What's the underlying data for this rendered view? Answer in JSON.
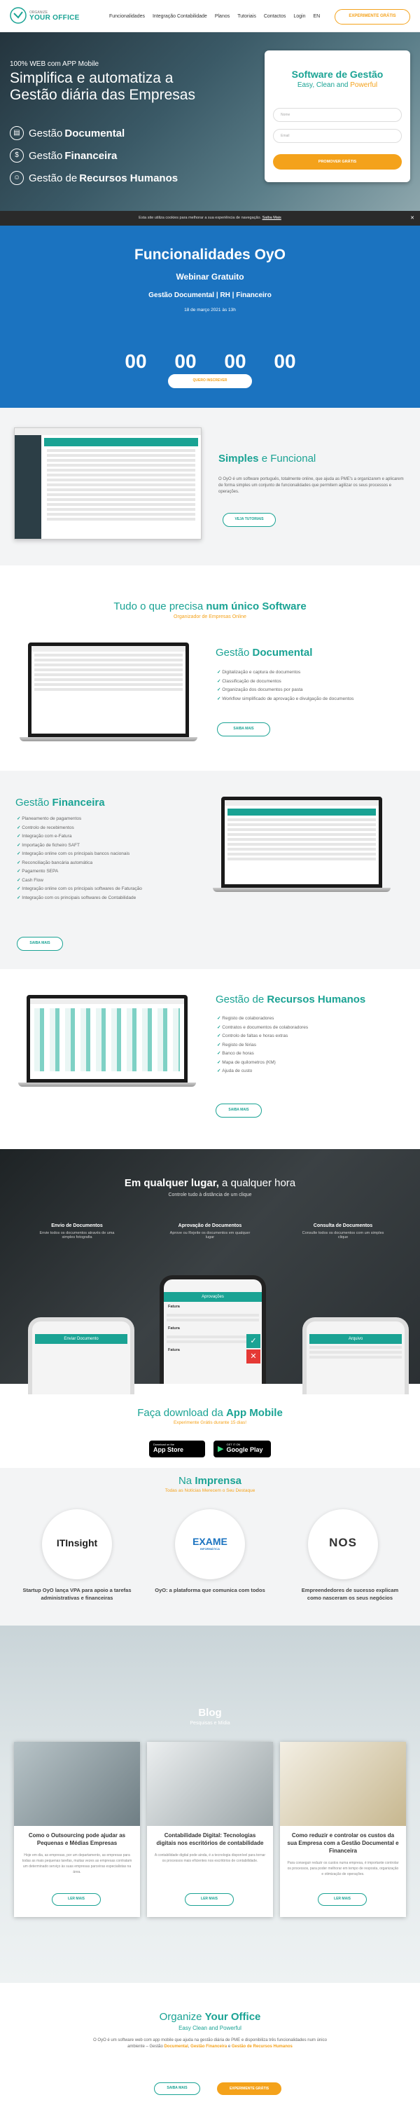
{
  "header": {
    "logo_top": "ORGANIZE",
    "logo_main": "YOUR OFFICE",
    "nav": [
      "Funcionalidades",
      "Integração Contabilidade",
      "Planos",
      "Tutoriais",
      "Contactos",
      "Login",
      "EN"
    ],
    "cta": "EXPERIMENTE GRÁTIS"
  },
  "hero": {
    "tag": "100% WEB com APP Mobile",
    "title1": "Simplifica e automatiza a",
    "title2": "Gestão diária das Empresas",
    "features": [
      {
        "pre": "Gestão ",
        "bold": "Documental"
      },
      {
        "pre": "Gestão ",
        "bold": "Financeira"
      },
      {
        "pre": "Gestão de ",
        "bold": "Recursos Humanos"
      }
    ]
  },
  "form": {
    "title": "Software de Gestão",
    "sub_a": "Easy, Clean and ",
    "sub_b": "Powerful",
    "name_ph": "Nome",
    "email_ph": "Email",
    "submit": "PROMOVER GRÁTIS"
  },
  "cookie": {
    "text": "Esta site utiliza cookies para melhorar a sua experiência de navegação.",
    "link": "Saiba Mais",
    "close": "✕"
  },
  "webinar": {
    "title": "Funcionalidades OyO",
    "sub": "Webinar Gratuito",
    "topics": "Gestão Documental | RH | Financeiro",
    "date": "18 de março 2021 às 13h",
    "counts": [
      "00",
      "00",
      "00",
      "00"
    ],
    "cta": "QUERO INSCREVER"
  },
  "simple": {
    "title_a": "Simples",
    "title_b": " e Funcional",
    "p": "O OyO é um software português, totalmente online, que ajuda as PME's a organizarem e aplicarem de forma simples um conjunto de funcionalidades que permitem agilizar os seus processos e operações.",
    "cta": "VEJA TUTORIAIS"
  },
  "need": {
    "title_a": "Tudo o que precisa ",
    "title_b": "num único Software",
    "sub": "Organizador de Empresas Online"
  },
  "doc": {
    "title_a": "Gestão ",
    "title_b": "Documental",
    "items": [
      "Digitalização e captura de documentos",
      "Classificação de documentos",
      "Organização dos documentos por pasta",
      "Workflow simplificado de aprovação e divulgação de documentos"
    ],
    "cta": "SAIBA MAIS"
  },
  "fin": {
    "title_a": "Gestão ",
    "title_b": "Financeira",
    "items": [
      "Planeamento de pagamentos",
      "Controlo de recebimentos",
      "Integração com e-Fatura",
      "Importação de ficheiro SAFT",
      "Integração online com os principais bancos nacionais",
      "Reconciliação bancária automática",
      "Pagamento SEPA",
      "Cash Flow",
      "Integração online com os principais softwares de Faturação",
      "Integração com os principais softwares de Contabilidade"
    ],
    "cta": "SAIBA MAIS"
  },
  "rh": {
    "title_a": "Gestão de ",
    "title_b": "Recursos Humanos",
    "items": [
      "Registo de colaboradores",
      "Contratos e documentos de colaboradores",
      "Controlo de faltas e horas extras",
      "Registo de férias",
      "Banco de horas",
      "Mapa de quilometros (KM)",
      "Ajuda de custo"
    ],
    "cta": "SAIBA MAIS"
  },
  "any": {
    "title_a": "Em qualquer lugar,",
    "title_b": " a qualquer hora",
    "sub": "Controle tudo à distância de um clique",
    "cols": [
      {
        "t": "Envio de Documentos",
        "d": "Envie todos os documentos através de uma simples fotografia"
      },
      {
        "t": "Aprovação de Documentos",
        "d": "Aprove ou Rejeite os documentos em qualquer lugar"
      },
      {
        "t": "Consulta de Documentos",
        "d": "Consulte todos os documentos com um simples clique"
      }
    ],
    "phone_left": "Enviar Documento",
    "phone_mid": "Aprovações",
    "phone_right": "Arquivo",
    "mid_rows": [
      "Fatura",
      "Fatura",
      "Fatura"
    ]
  },
  "app": {
    "title_a": "Faça download da ",
    "title_b": "App Mobile",
    "sub": "Experimente Grátis durante 15 dias!",
    "ios_top": "Download on the",
    "ios": "App Store",
    "and_top": "GET IT ON",
    "and": "Google Play"
  },
  "press": {
    "title_a": "Na ",
    "title_b": "Imprensa",
    "sub": "Todas as Notícias Merecem o Seu Destaque",
    "items": [
      {
        "logo_a": "IT",
        "logo_b": "Insight",
        "caption": "Startup OyO lança VPA para apoio a tarefas administrativas e financeiras"
      },
      {
        "logo_a": "EXAME",
        "logo_b": "INFORMÁTICA",
        "caption": "OyO: a plataforma que comunica com todos"
      },
      {
        "logo_a": "NOS",
        "logo_b": "",
        "caption": "Empreendedores de sucesso explicam como nasceram os seus negócios"
      }
    ]
  },
  "blog": {
    "title": "Blog",
    "sub": "Pesquisas e Mídia",
    "posts": [
      {
        "t": "Como o Outsourcing pode ajudar as Pequenas e Médias Empresas",
        "d": "Hoje em dia, as empresas, por um departamento, as empresas para todas as mais pequenas tarefas, muitas vezes as empresas contratam um determinado serviço às suas empresas parceiras especialistas na área.",
        "cta": "LER MAIS"
      },
      {
        "t": "Contabilidade Digital: Tecnologias digitais nos escritórios de contabilidade",
        "d": "A contabilidade digital pode ainda, é a tecnologia disponível para tornar os processos mais eficientes nos escritórios de contabilidade.",
        "cta": "LER MAIS"
      },
      {
        "t": "Como reduzir e controlar os custos da sua Empresa com a Gestão Documental e Financeira",
        "d": "Para conseguir reduzir os custos numa empresa, é importante controlar os processos, para poder melhorar em tempo de resposta, organização e otimização de operações.",
        "cta": "LER MAIS"
      }
    ]
  },
  "footer": {
    "title_a": "Organize ",
    "title_b": "Your Office",
    "sub": "Easy Clean and Powerful",
    "p1": "O OyO é um software web com app mobile que ajuda na gestão diária de PME e disponibiliza três funcionalidades num único ambiente – Gestão ",
    "b1": "Documental",
    ", ": ", ",
    "b2": "Gestão Financeira",
    "p2": " e ",
    "b3": "Gestão de Recursos Humanos",
    "cta1": "SAIBA MAIS",
    "cta2": "EXPERIMENTE GRÁTIS"
  },
  "colors": {
    "teal": "#1aa394",
    "orange": "#f4a21b",
    "blue": "#1b73c0"
  }
}
